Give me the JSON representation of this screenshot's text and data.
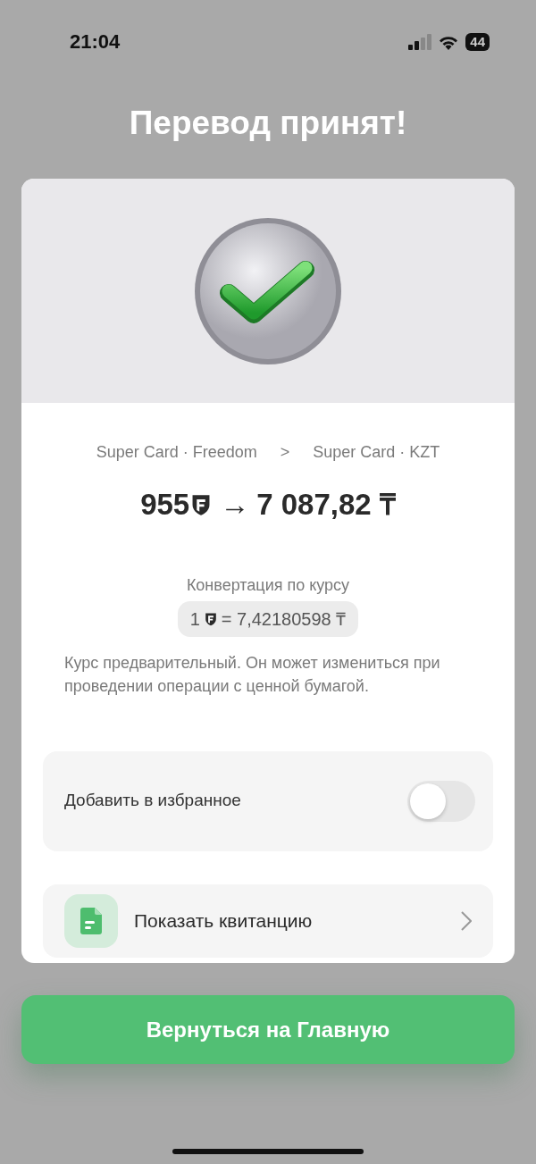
{
  "status_bar": {
    "time": "21:04",
    "battery": "44"
  },
  "title": "Перевод принят!",
  "route": {
    "from": "Super Card · Freedom",
    "separator": ">",
    "to": "Super Card · KZT"
  },
  "amount": {
    "from": "955",
    "arrow": "→",
    "to": "7 087,82 ₸"
  },
  "conversion": {
    "label": "Конвертация по курсу",
    "rate_from": "1",
    "rate_to": "= 7,42180598 ₸"
  },
  "note": "Курс предварительный. Он может измениться при проведении операции с ценной бумагой.",
  "favorite": {
    "label": "Добавить в избранное",
    "on": false
  },
  "receipt": {
    "label": "Показать квитанцию"
  },
  "primary_button": "Вернуться на Главную"
}
